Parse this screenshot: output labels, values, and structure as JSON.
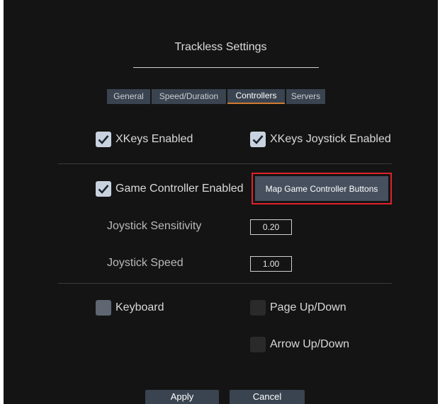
{
  "dialog": {
    "title": "Trackless Settings"
  },
  "tabs": [
    {
      "label": "General"
    },
    {
      "label": "Speed/Duration"
    },
    {
      "label": "Controllers"
    },
    {
      "label": "Servers"
    }
  ],
  "controllers": {
    "xkeys_enabled": {
      "label": "XKeys Enabled",
      "checked": true
    },
    "xkeys_joystick_enabled": {
      "label": "XKeys Joystick Enabled",
      "checked": true
    },
    "game_controller_enabled": {
      "label": "Game Controller Enabled",
      "checked": true
    },
    "map_button_label": "Map Game Controller Buttons",
    "joystick_sensitivity": {
      "label": "Joystick Sensitivity",
      "value": "0.20"
    },
    "joystick_speed": {
      "label": "Joystick Speed",
      "value": "1.00"
    },
    "keyboard": {
      "label": "Keyboard",
      "checked": false
    },
    "page_up_down": {
      "label": "Page Up/Down",
      "checked": false
    },
    "arrow_up_down": {
      "label": "Arrow Up/Down",
      "checked": false
    }
  },
  "footer": {
    "apply_label": "Apply",
    "cancel_label": "Cancel"
  },
  "colors": {
    "accent_tab_underline": "#d07a30",
    "highlight_border": "#e0212b",
    "background": "#141414"
  }
}
